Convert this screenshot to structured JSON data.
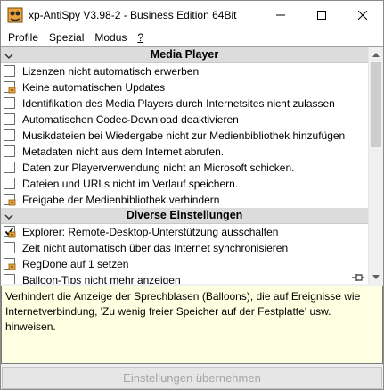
{
  "window": {
    "title": "xp-AntiSpy V3.98-2 -  Business Edition 64Bit"
  },
  "menu": [
    "Profile",
    "Spezial",
    "Modus",
    "?"
  ],
  "groups": [
    {
      "title": "Media Player",
      "options": [
        {
          "label": "Lizenzen nicht automatisch erwerben",
          "checked": false,
          "user_specific": false
        },
        {
          "label": "Keine automatischen Updates",
          "checked": false,
          "user_specific": true
        },
        {
          "label": "Identifikation des Media Players durch Internetsites nicht zulassen",
          "checked": false,
          "user_specific": false
        },
        {
          "label": "Automatischen Codec-Download deaktivieren",
          "checked": false,
          "user_specific": false
        },
        {
          "label": "Musikdateien bei Wiedergabe nicht zur Medienbibliothek hinzufügen",
          "checked": false,
          "user_specific": false
        },
        {
          "label": "Metadaten nicht aus dem Internet abrufen.",
          "checked": false,
          "user_specific": false
        },
        {
          "label": "Daten zur Playerverwendung nicht an Microsoft schicken.",
          "checked": false,
          "user_specific": false
        },
        {
          "label": "Dateien und URLs nicht im Verlauf speichern.",
          "checked": false,
          "user_specific": false
        },
        {
          "label": "Freigabe der Medienbibliothek verhindern",
          "checked": false,
          "user_specific": true
        }
      ]
    },
    {
      "title": "Diverse Einstellungen",
      "options": [
        {
          "label": "Explorer: Remote-Desktop-Unterstützung ausschalten",
          "checked": true,
          "user_specific": true
        },
        {
          "label": "Zeit nicht automatisch über das Internet synchronisieren",
          "checked": false,
          "user_specific": false
        },
        {
          "label": "RegDone auf 1 setzen",
          "checked": false,
          "user_specific": true
        },
        {
          "label": "Balloon-Tips nicht mehr anzeigen",
          "checked": false,
          "user_specific": false
        }
      ]
    }
  ],
  "description": "Verhindert die Anzeige der Sprechblasen (Balloons), die auf Ereignisse wie Internetverbindung, 'Zu wenig freier Speicher auf der Festplatte' usw. hinweisen.",
  "apply_button": "Einstellungen übernehmen",
  "colors": {
    "description_bg": "#ffffe1",
    "group_header_bg": "#dcdcdc",
    "disabled_text": "#a5a5a5"
  }
}
